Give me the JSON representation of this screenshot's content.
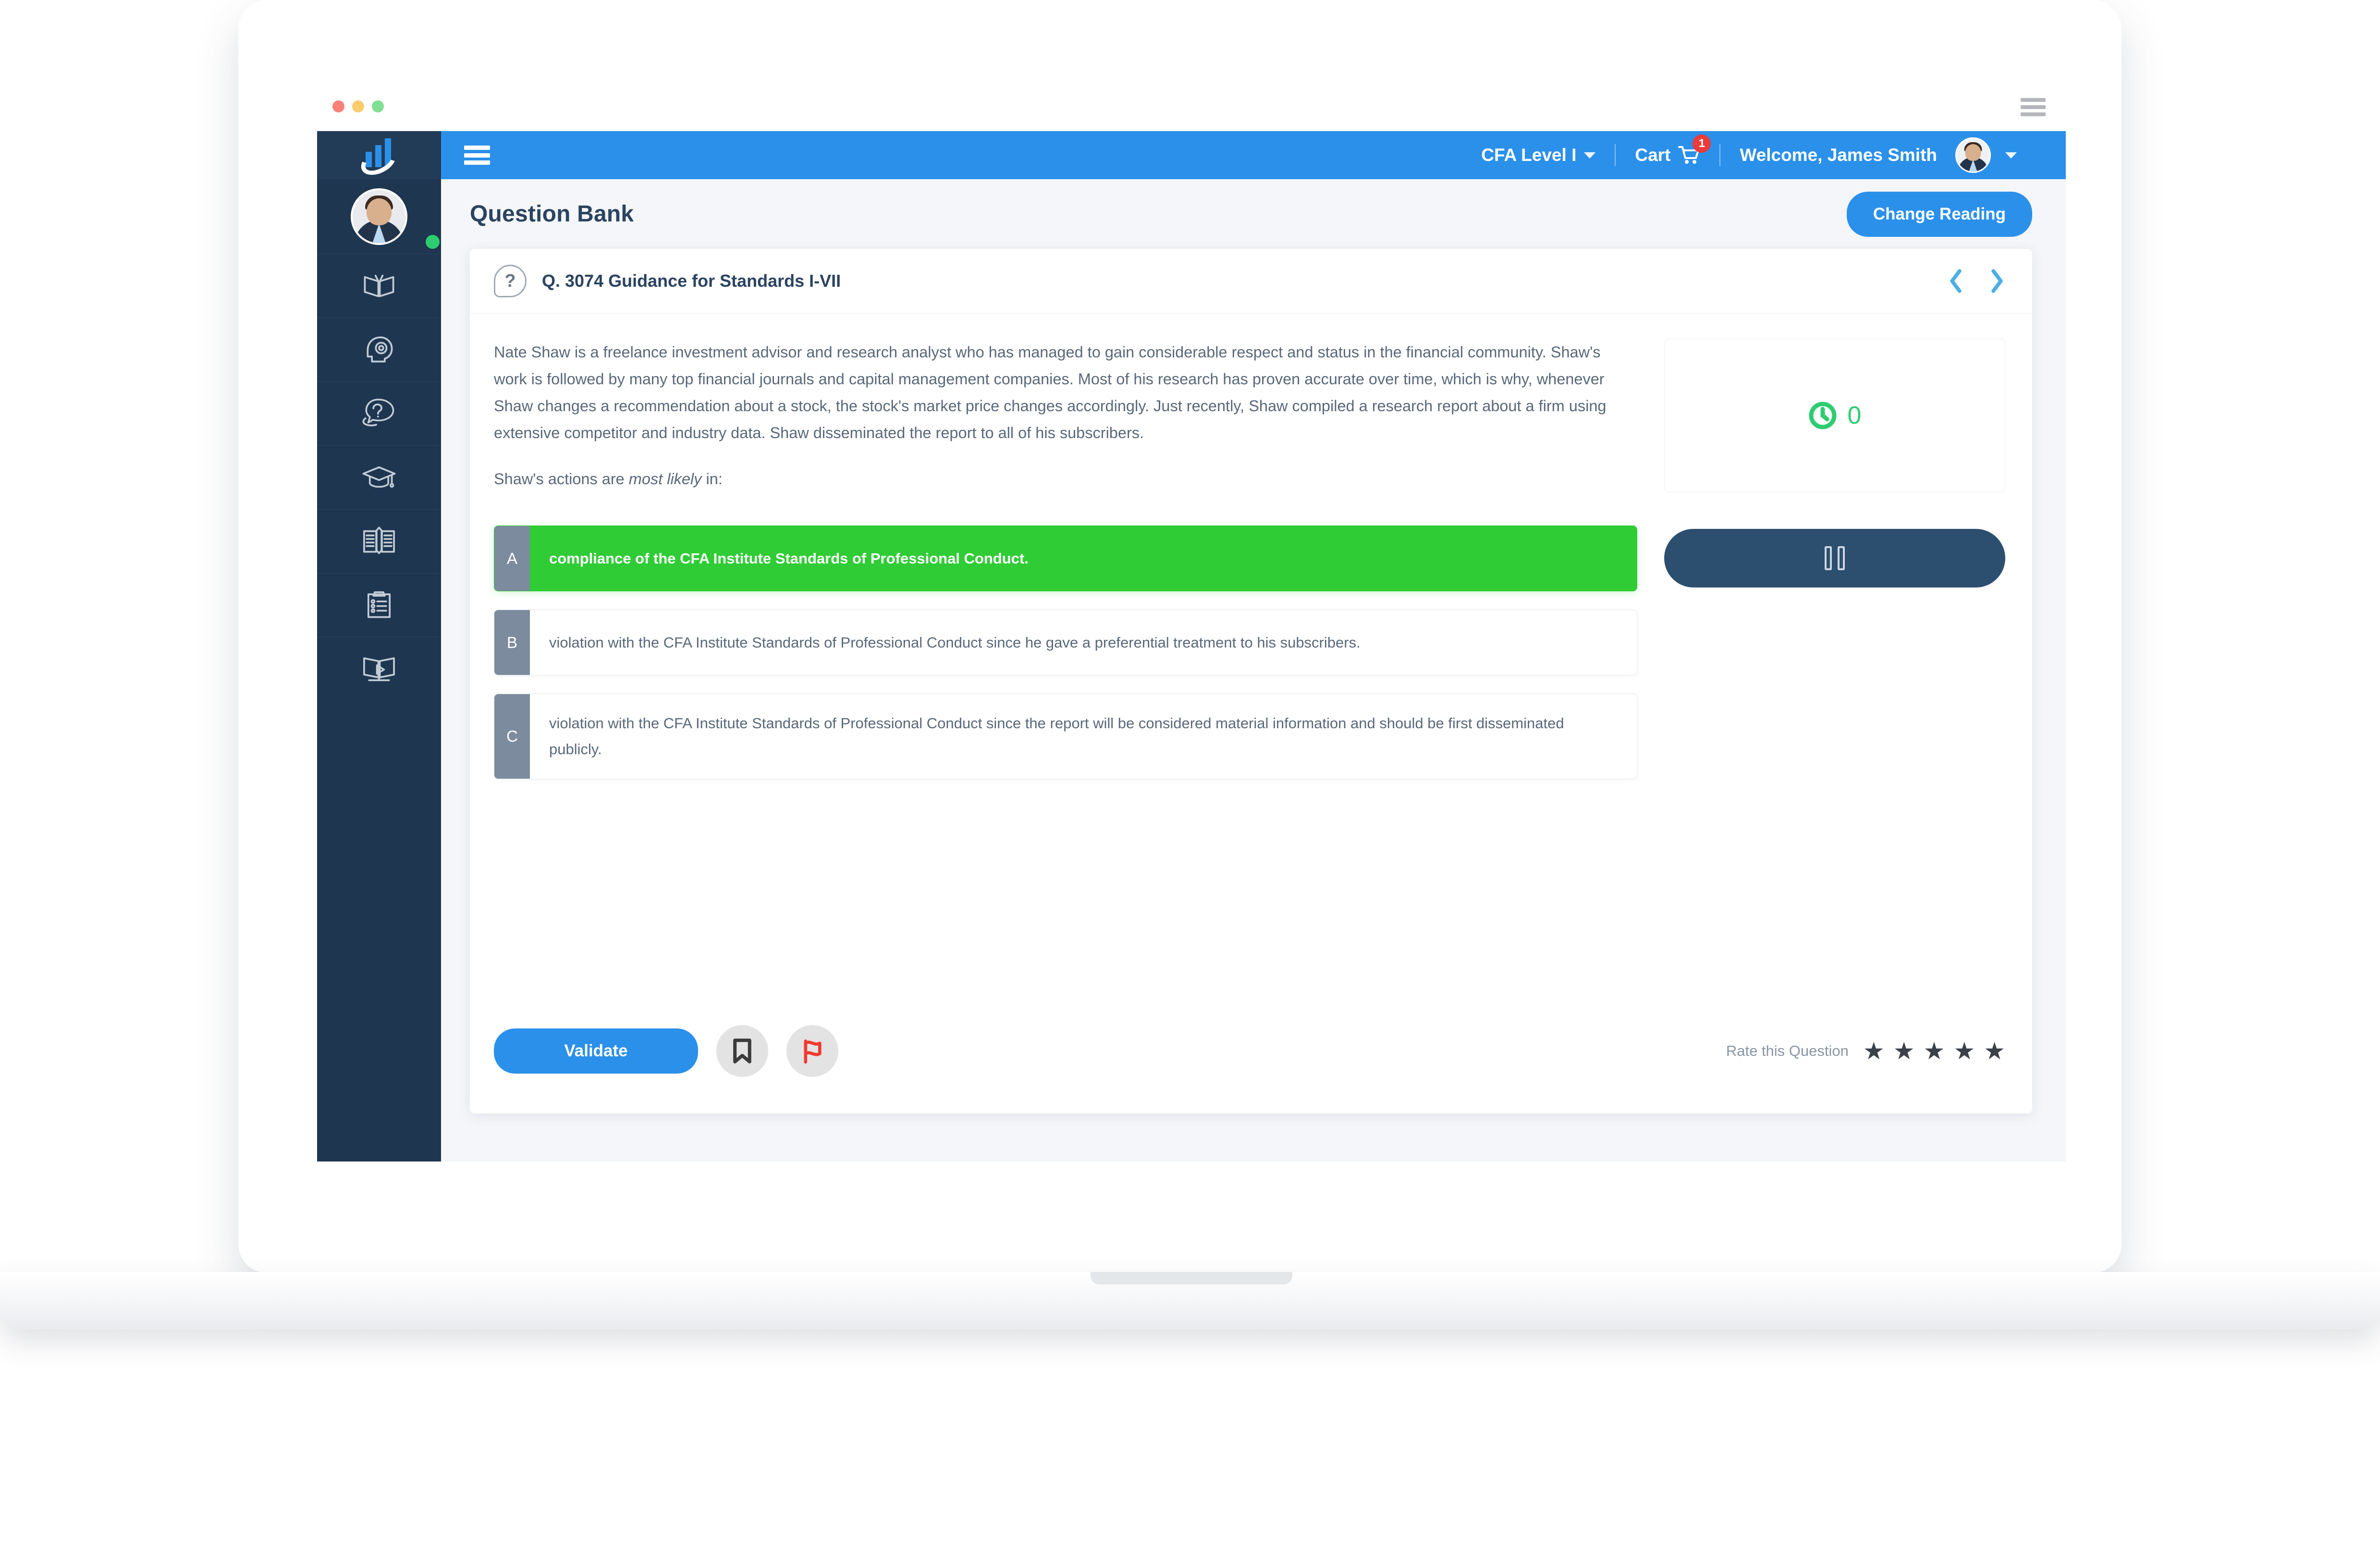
{
  "browser": {
    "traffic_lights": [
      "red",
      "yellow",
      "green"
    ],
    "menu_icon": "hamburger-icon"
  },
  "sidebar": {
    "logo_icon": "bar-chart-swoosh-logo",
    "avatar_icon": "user-avatar",
    "status": "online",
    "items": [
      {
        "icon": "open-book-icon",
        "name": "study-materials"
      },
      {
        "icon": "head-gear-icon",
        "name": "mock-exams"
      },
      {
        "icon": "question-chat-icon",
        "name": "question-bank"
      },
      {
        "icon": "graduation-cap-icon",
        "name": "courses"
      },
      {
        "icon": "book-pencil-icon",
        "name": "notes"
      },
      {
        "icon": "clipboard-checklist-icon",
        "name": "practice-tests"
      },
      {
        "icon": "book-video-icon",
        "name": "video-lessons"
      }
    ]
  },
  "topbar": {
    "menu_icon": "hamburger-icon",
    "level_label": "CFA Level I",
    "level_caret": "chevron-down-icon",
    "cart_label": "Cart",
    "cart_icon": "shopping-cart-icon",
    "cart_badge": "1",
    "welcome_label": "Welcome, James Smith",
    "user_caret": "chevron-down-icon"
  },
  "page": {
    "title": "Question Bank",
    "change_reading_label": "Change Reading"
  },
  "question": {
    "icon": "question-mark-icon",
    "title": "Q. 3074 Guidance for Standards I-VII",
    "prev_icon": "chevron-left-icon",
    "next_icon": "chevron-right-icon",
    "body": "Nate Shaw is a freelance investment advisor and research analyst who has managed to gain considerable respect and status in the financial community. Shaw's work is followed by many top financial journals and capital management companies. Most of his research has proven accurate over time, which is why, whenever Shaw changes a recommendation about a stock, the stock's market price changes accordingly. Just recently, Shaw compiled a research report about a firm using extensive competitor and industry data. Shaw disseminated the report to all of his subscribers.",
    "prompt_pre": "Shaw's actions are ",
    "prompt_em": "most likely",
    "prompt_post": " in:",
    "options": [
      {
        "letter": "A",
        "text": "compliance of the CFA Institute Standards of Professional Conduct.",
        "state": "correct"
      },
      {
        "letter": "B",
        "text": "violation with the CFA Institute Standards of Professional Conduct since he gave a preferential treatment to his subscribers.",
        "state": "default"
      },
      {
        "letter": "C",
        "text": "violation with the CFA Institute Standards of Professional Conduct since the report will be considered material information and should be first disseminated publicly.",
        "state": "default"
      }
    ]
  },
  "actions": {
    "validate_label": "Validate",
    "bookmark_icon": "bookmark-icon",
    "flag_icon": "flag-icon",
    "rate_label": "Rate this Question",
    "stars": [
      "★",
      "★",
      "★",
      "★",
      "★"
    ],
    "star_count": 5
  },
  "timer": {
    "icon": "clock-icon",
    "value": "0",
    "pause_icon": "pause-icon"
  },
  "colors": {
    "accent_blue": "#2b90ea",
    "sidebar_navy": "#1e3650",
    "correct_green": "#2fcc35",
    "timer_green": "#2ecc71",
    "badge_red": "#ec3b3b",
    "letter_slate": "#7c8b9e",
    "pause_navy": "#2c4f70"
  }
}
